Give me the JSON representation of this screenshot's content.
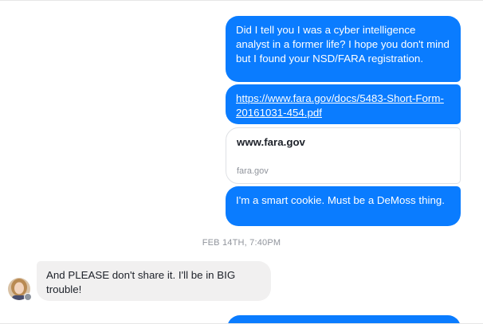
{
  "messages": {
    "m1": "Did I tell you I was a cyber intelligence analyst in a former life? I hope you don't mind but I found your NSD/FARA registration.",
    "m2_link": "https://www.fara.gov/docs/5483-Short-Form-20161031-454.pdf",
    "m3": "I'm a smart cookie. Must be a DeMoss thing.",
    "m4": "And PLEASE don't share it.  I'll be in BIG trouble!"
  },
  "link_preview": {
    "title": "www.fara.gov",
    "domain": "fara.gov"
  },
  "timestamp": "FEB 14TH, 7:40PM",
  "colors": {
    "sent_bubble": "#0a7cff",
    "received_bubble": "#f1f0f0",
    "timestamp_text": "#90949c"
  },
  "icons": {
    "avatar": "contact-avatar",
    "badge": "messenger-badge-icon"
  }
}
